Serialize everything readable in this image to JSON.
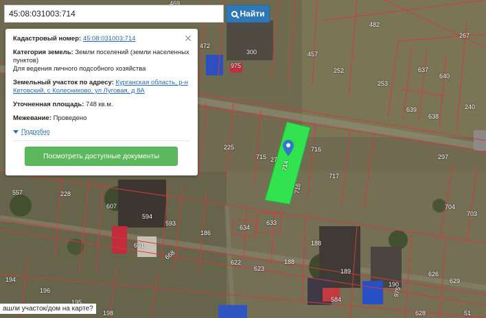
{
  "search": {
    "value": "45:08:031003:714",
    "button_label": "Найти"
  },
  "card": {
    "cadastral_label": "Кадастровый номер:",
    "cadastral_value": "45:08:031003:714",
    "category_label": "Категория земель:",
    "category_value": "Земли поселений (земли населенных пунктов)",
    "category_use": "Для ведения личного подсобного хозяйства",
    "address_label": "Земельный участок по адресу:",
    "address_value": "Курганская область, р-н Кетовский, с Колесниково, ул Луговая, д 8А",
    "area_label": "Уточненная площадь:",
    "area_value": "748 кв.м.",
    "survey_label": "Межевание:",
    "survey_value": "Проведено",
    "details_link": "Подробно",
    "docs_button": "Посмотреть доступные документы"
  },
  "highlight": {
    "label": "714",
    "color": "#2eea4f"
  },
  "parcels": [
    "469",
    "482",
    "267",
    "472",
    "300",
    "457",
    "975",
    "252",
    "637",
    "640",
    "253",
    "240",
    "639",
    "638",
    "225",
    "715",
    "27",
    "716",
    "297",
    "717",
    "557",
    "228",
    "607",
    "594",
    "593",
    "716",
    "704",
    "703",
    "634",
    "633",
    "186",
    "188",
    "691",
    "668",
    "622",
    "623",
    "188",
    "189",
    "626",
    "629",
    "194",
    "196",
    "195",
    "198",
    "584",
    "975",
    "190",
    "628",
    "51"
  ],
  "bottom_question": "ашли участок/дом на карте?",
  "colors": {
    "accent": "#2f78b8",
    "link": "#2a6bb0",
    "button_green": "#5cb85c",
    "boundary": "#d23a3a"
  }
}
